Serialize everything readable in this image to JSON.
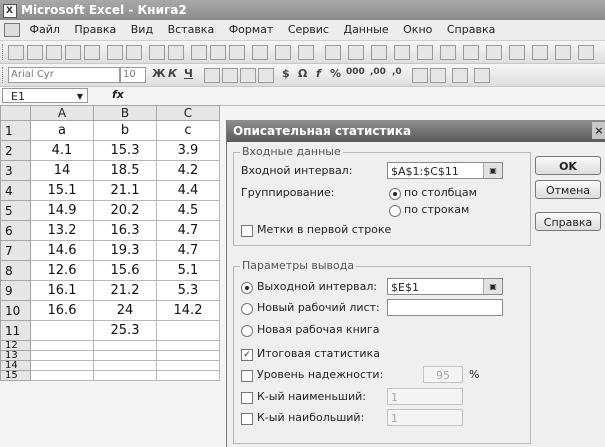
{
  "app": {
    "title": "Microsoft Excel - Книга2"
  },
  "menu": [
    "Файл",
    "Правка",
    "Вид",
    "Вставка",
    "Формат",
    "Сервис",
    "Данные",
    "Окно",
    "Справка"
  ],
  "toolbar": {
    "font_name": "Arial Cyr",
    "font_size": "10"
  },
  "formula_bar": {
    "name_box": "E1",
    "fx": "fx"
  },
  "sheet": {
    "columns": [
      "A",
      "B",
      "C"
    ],
    "rows": [
      {
        "n": "1",
        "cells": [
          "a",
          "b",
          "c"
        ]
      },
      {
        "n": "2",
        "cells": [
          "4.1",
          "15.3",
          "3.9"
        ]
      },
      {
        "n": "3",
        "cells": [
          "14",
          "18.5",
          "4.2"
        ]
      },
      {
        "n": "4",
        "cells": [
          "15.1",
          "21.1",
          "4.4"
        ]
      },
      {
        "n": "5",
        "cells": [
          "14.9",
          "20.2",
          "4.5"
        ]
      },
      {
        "n": "6",
        "cells": [
          "13.2",
          "16.3",
          "4.7"
        ]
      },
      {
        "n": "7",
        "cells": [
          "14.6",
          "19.3",
          "4.7"
        ]
      },
      {
        "n": "8",
        "cells": [
          "12.6",
          "15.6",
          "5.1"
        ]
      },
      {
        "n": "9",
        "cells": [
          "16.1",
          "21.2",
          "5.3"
        ]
      },
      {
        "n": "10",
        "cells": [
          "16.6",
          "24",
          "14.2"
        ]
      },
      {
        "n": "11",
        "cells": [
          "",
          "25.3",
          ""
        ]
      }
    ],
    "small_rows": [
      "12",
      "13",
      "14",
      "15"
    ]
  },
  "dialog": {
    "title": "Описательная статистика",
    "input_group": "Входные данные",
    "input_range_label": "Входной интервал:",
    "input_range_value": "$A$1:$C$11",
    "grouping_label": "Группирование:",
    "by_columns": "по столбцам",
    "by_rows": "по строкам",
    "labels_first_row": "Метки в первой строке",
    "output_group": "Параметры вывода",
    "output_range_label": "Выходной интервал:",
    "output_range_value": "$E$1",
    "new_sheet_label": "Новый рабочий лист:",
    "new_book_label": "Новая рабочая книга",
    "summary_stats": "Итоговая статистика",
    "confidence_label": "Уровень надежности:",
    "confidence_value": "95",
    "percent": "%",
    "kth_smallest": "К-ый наименьший:",
    "kth_largest": "К-ый наибольший:",
    "kth_value": "1",
    "ok": "OK",
    "cancel": "Отмена",
    "help": "Справка",
    "close": "×"
  }
}
